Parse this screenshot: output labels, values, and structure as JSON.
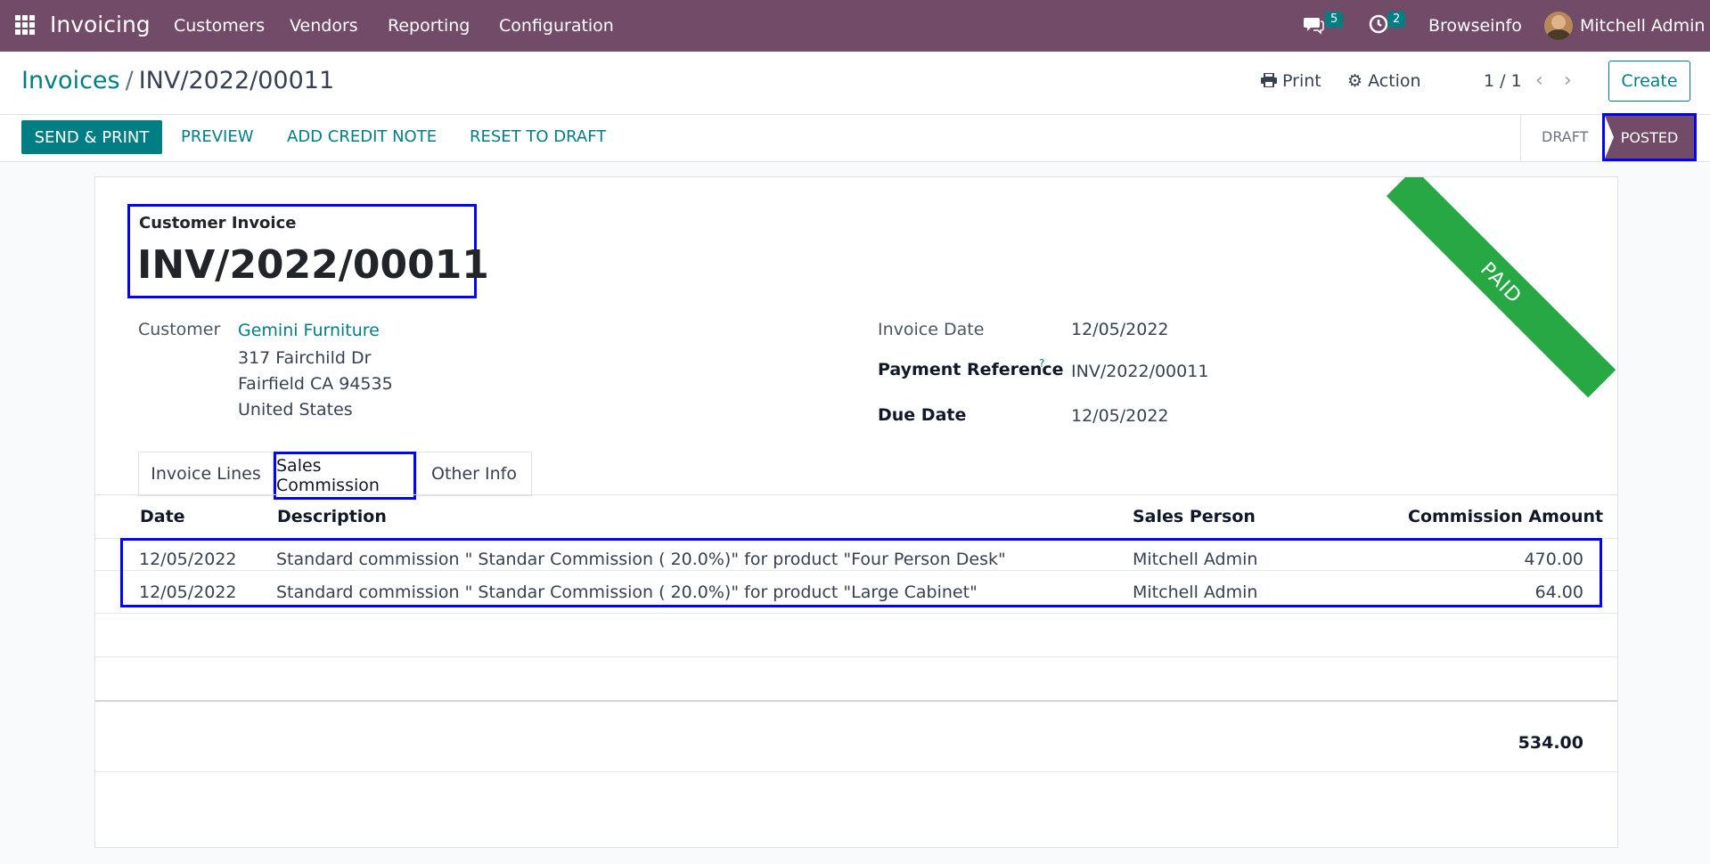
{
  "navbar": {
    "brand": "Invoicing",
    "menus": [
      "Customers",
      "Vendors",
      "Reporting",
      "Configuration"
    ],
    "messages_count": "5",
    "activities_count": "2",
    "company": "Browseinfo",
    "user": "Mitchell Admin"
  },
  "controlpanel": {
    "breadcrumb_parent": "Invoices",
    "breadcrumb_current": "INV/2022/00011",
    "print_label": "Print",
    "action_label": "Action",
    "pager": "1 / 1",
    "create_label": "Create"
  },
  "statusbar": {
    "send_print": "SEND & PRINT",
    "preview": "PREVIEW",
    "add_credit_note": "ADD CREDIT NOTE",
    "reset_to_draft": "RESET TO DRAFT",
    "stage_draft": "DRAFT",
    "stage_posted": "POSTED"
  },
  "sheet": {
    "ribbon": "PAID",
    "doc_type": "Customer Invoice",
    "doc_number": "INV/2022/00011",
    "customer_label": "Customer",
    "customer_name": "Gemini Furniture",
    "address_line1": "317 Fairchild Dr",
    "address_line2": "Fairfield CA 94535",
    "address_line3": "United States",
    "invoice_date_label": "Invoice Date",
    "invoice_date": "12/05/2022",
    "payment_ref_label": "Payment Reference",
    "payment_ref_help": "?",
    "payment_ref": "INV/2022/00011",
    "due_date_label": "Due Date",
    "due_date": "12/05/2022"
  },
  "tabs": [
    "Invoice Lines",
    "Sales Commission",
    "Other Info"
  ],
  "table": {
    "columns": [
      "Date",
      "Description",
      "Sales Person",
      "Commission Amount"
    ],
    "rows": [
      {
        "date": "12/05/2022",
        "description": "Standard commission \" Standar Commission ( 20.0%)\" for product \"Four Person Desk\"",
        "person": "Mitchell Admin",
        "amount": "470.00"
      },
      {
        "date": "12/05/2022",
        "description": "Standard commission \" Standar Commission ( 20.0%)\" for product \"Large Cabinet\"",
        "person": "Mitchell Admin",
        "amount": "64.00"
      }
    ],
    "total": "534.00"
  }
}
